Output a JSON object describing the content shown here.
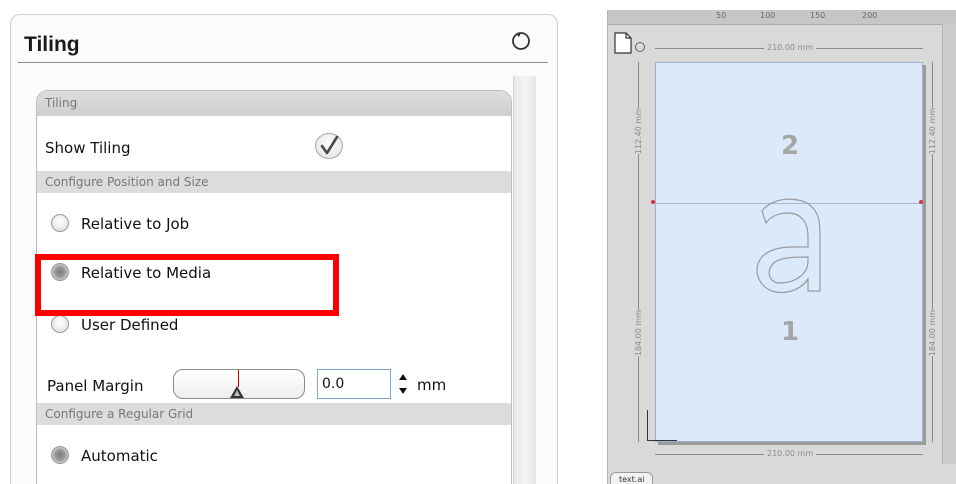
{
  "panel": {
    "title": "Tiling",
    "reset_icon": "reset-icon",
    "sections": {
      "tiling_header": "Tiling",
      "position_header": "Configure Position and Size",
      "grid_header": "Configure a Regular Grid"
    },
    "show_tiling": {
      "label": "Show Tiling",
      "checked": true
    },
    "position_options": [
      {
        "label": "Relative to Job",
        "selected": false
      },
      {
        "label": "Relative to Media",
        "selected": true
      },
      {
        "label": "User Defined",
        "selected": false
      }
    ],
    "panel_margin": {
      "label": "Panel Margin",
      "value": "0.0",
      "unit": "mm"
    },
    "grid_options": [
      {
        "label": "Automatic",
        "selected": true
      }
    ]
  },
  "preview": {
    "ruler_top_labels": [
      "50",
      "100",
      "150",
      "200"
    ],
    "width_dimension": "210.00 mm",
    "top_tile_height": "112.40 mm",
    "bottom_tile_height": "184.00 mm",
    "tile_numbers": [
      "2",
      "1"
    ],
    "tab_label": "text.ai",
    "highlight_color": "#ff0000",
    "page_color": "#dce9fb"
  }
}
